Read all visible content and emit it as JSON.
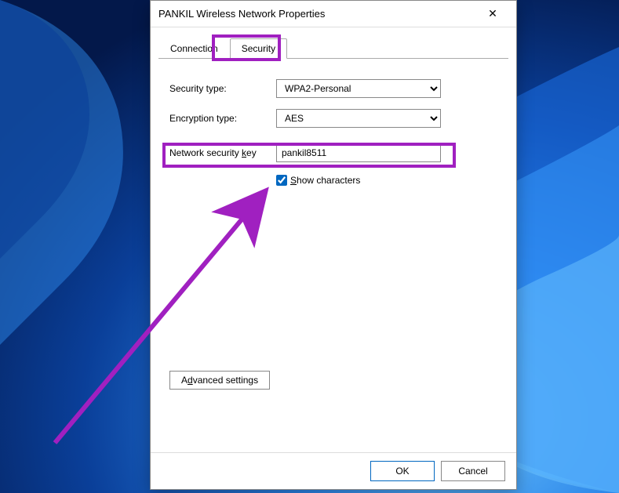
{
  "dialog": {
    "title": "PANKIL Wireless Network Properties",
    "close_icon": "✕",
    "tabs": {
      "connection": "Connection",
      "security": "Security"
    },
    "fields": {
      "security_type_label": "Security type:",
      "security_type_value": "WPA2-Personal",
      "encryption_type_label": "Encryption type:",
      "encryption_type_value": "AES",
      "network_key_label_pre": "Network security ",
      "network_key_label_u": "k",
      "network_key_label_post": "ey",
      "network_key_value": "pankil8511",
      "show_chars_u": "S",
      "show_chars_post": "how characters"
    },
    "advanced_pre": "A",
    "advanced_u": "d",
    "advanced_post": "vanced settings",
    "buttons": {
      "ok": "OK",
      "cancel": "Cancel"
    }
  }
}
